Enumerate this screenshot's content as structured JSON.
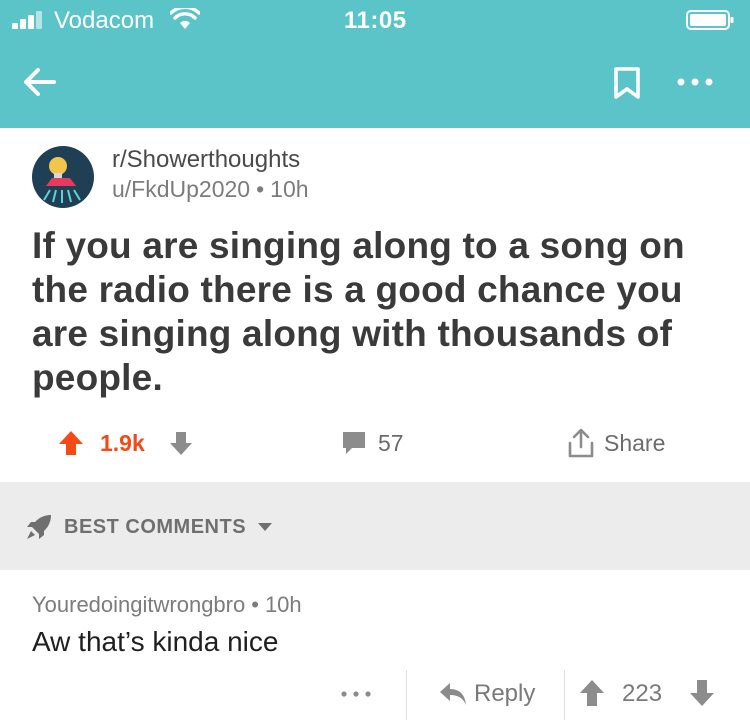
{
  "status_bar": {
    "carrier": "Vodacom",
    "time": "11:05"
  },
  "nav": {
    "back_icon": "arrow-left-icon",
    "save_icon": "bookmark-icon",
    "more_icon": "more-horizontal-icon"
  },
  "post": {
    "subreddit": "r/Showerthoughts",
    "author": "u/FkdUp2020",
    "separator": "•",
    "age": "10h",
    "title": "If you are singing along to a song on the radio there is a good chance you are singing along with thousands of people.",
    "score": "1.9k",
    "comment_count": "57",
    "share_label": "Share"
  },
  "sort": {
    "label": "BEST COMMENTS"
  },
  "comment": {
    "author": "Youredoingitwrongbro",
    "separator": "•",
    "age": "10h",
    "body": "Aw that’s kinda nice",
    "reply_label": "Reply",
    "score": "223"
  },
  "colors": {
    "header": "#5bc4c8",
    "upvote_active": "#f54a18",
    "band": "#ececec",
    "avatar_bg": "#1f3f55"
  }
}
